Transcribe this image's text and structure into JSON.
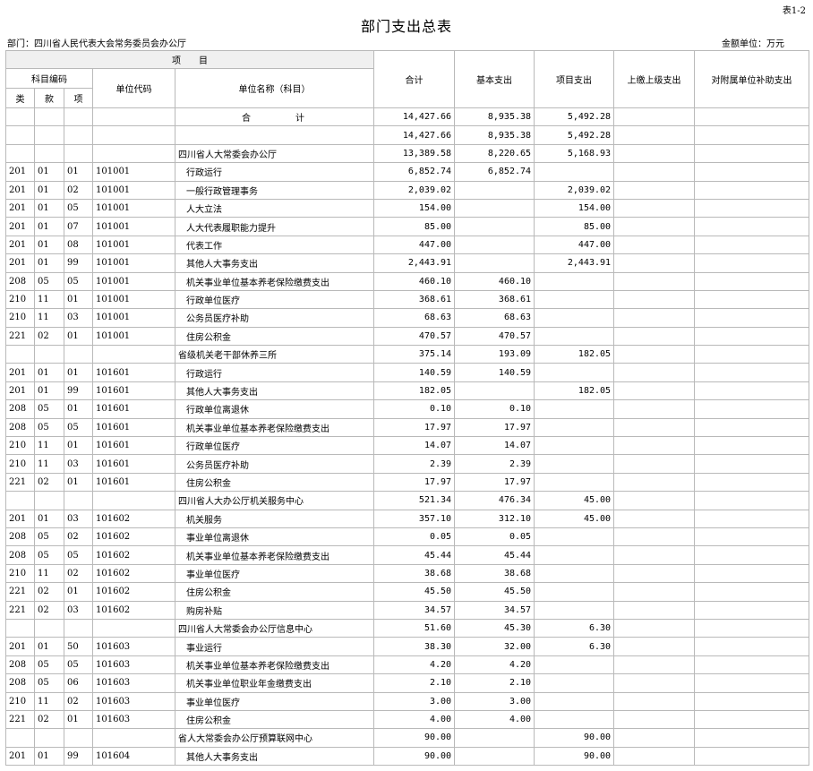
{
  "header": {
    "table_no": "表1-2",
    "title": "部门支出总表",
    "department": "部门：四川省人民代表大会常务委员会办公厅",
    "unit": "金额单位：万元"
  },
  "columns": {
    "project": "项　　目",
    "subject_code": "科目编码",
    "lei": "类",
    "kuan": "款",
    "xiang": "项",
    "unit_code": "单位代码",
    "unit_name": "单位名称（科目）",
    "total": "合计",
    "basic": "基本支出",
    "project_exp": "项目支出",
    "upper": "上缴上级支出",
    "subsidy": "对附属单位补助支出"
  },
  "rows": [
    {
      "lei": "",
      "kuan": "",
      "xiang": "",
      "code": "",
      "name": "合　计",
      "total": "14,427.66",
      "basic": "8,935.38",
      "project": "5,492.28",
      "kind": "total"
    },
    {
      "lei": "",
      "kuan": "",
      "xiang": "",
      "code": "",
      "name": "",
      "total": "14,427.66",
      "basic": "8,935.38",
      "project": "5,492.28",
      "kind": "unit"
    },
    {
      "lei": "",
      "kuan": "",
      "xiang": "",
      "code": "",
      "name": "四川省人大常委会办公厅",
      "total": "13,389.58",
      "basic": "8,220.65",
      "project": "5,168.93",
      "kind": "unit"
    },
    {
      "lei": "201",
      "kuan": "01",
      "xiang": "01",
      "code": "101001",
      "name": "行政运行",
      "total": "6,852.74",
      "basic": "6,852.74",
      "project": "",
      "kind": "item"
    },
    {
      "lei": "201",
      "kuan": "01",
      "xiang": "02",
      "code": "101001",
      "name": "一般行政管理事务",
      "total": "2,039.02",
      "basic": "",
      "project": "2,039.02",
      "kind": "item"
    },
    {
      "lei": "201",
      "kuan": "01",
      "xiang": "05",
      "code": "101001",
      "name": "人大立法",
      "total": "154.00",
      "basic": "",
      "project": "154.00",
      "kind": "item"
    },
    {
      "lei": "201",
      "kuan": "01",
      "xiang": "07",
      "code": "101001",
      "name": "人大代表履职能力提升",
      "total": "85.00",
      "basic": "",
      "project": "85.00",
      "kind": "item"
    },
    {
      "lei": "201",
      "kuan": "01",
      "xiang": "08",
      "code": "101001",
      "name": "代表工作",
      "total": "447.00",
      "basic": "",
      "project": "447.00",
      "kind": "item"
    },
    {
      "lei": "201",
      "kuan": "01",
      "xiang": "99",
      "code": "101001",
      "name": "其他人大事务支出",
      "total": "2,443.91",
      "basic": "",
      "project": "2,443.91",
      "kind": "item"
    },
    {
      "lei": "208",
      "kuan": "05",
      "xiang": "05",
      "code": "101001",
      "name": "机关事业单位基本养老保险缴费支出",
      "total": "460.10",
      "basic": "460.10",
      "project": "",
      "kind": "item"
    },
    {
      "lei": "210",
      "kuan": "11",
      "xiang": "01",
      "code": "101001",
      "name": "行政单位医疗",
      "total": "368.61",
      "basic": "368.61",
      "project": "",
      "kind": "item"
    },
    {
      "lei": "210",
      "kuan": "11",
      "xiang": "03",
      "code": "101001",
      "name": "公务员医疗补助",
      "total": "68.63",
      "basic": "68.63",
      "project": "",
      "kind": "item"
    },
    {
      "lei": "221",
      "kuan": "02",
      "xiang": "01",
      "code": "101001",
      "name": "住房公积金",
      "total": "470.57",
      "basic": "470.57",
      "project": "",
      "kind": "item"
    },
    {
      "lei": "",
      "kuan": "",
      "xiang": "",
      "code": "",
      "name": "省级机关老干部休养三所",
      "total": "375.14",
      "basic": "193.09",
      "project": "182.05",
      "kind": "unit"
    },
    {
      "lei": "201",
      "kuan": "01",
      "xiang": "01",
      "code": "101601",
      "name": "行政运行",
      "total": "140.59",
      "basic": "140.59",
      "project": "",
      "kind": "item"
    },
    {
      "lei": "201",
      "kuan": "01",
      "xiang": "99",
      "code": "101601",
      "name": "其他人大事务支出",
      "total": "182.05",
      "basic": "",
      "project": "182.05",
      "kind": "item"
    },
    {
      "lei": "208",
      "kuan": "05",
      "xiang": "01",
      "code": "101601",
      "name": "行政单位离退休",
      "total": "0.10",
      "basic": "0.10",
      "project": "",
      "kind": "item"
    },
    {
      "lei": "208",
      "kuan": "05",
      "xiang": "05",
      "code": "101601",
      "name": "机关事业单位基本养老保险缴费支出",
      "total": "17.97",
      "basic": "17.97",
      "project": "",
      "kind": "item"
    },
    {
      "lei": "210",
      "kuan": "11",
      "xiang": "01",
      "code": "101601",
      "name": "行政单位医疗",
      "total": "14.07",
      "basic": "14.07",
      "project": "",
      "kind": "item"
    },
    {
      "lei": "210",
      "kuan": "11",
      "xiang": "03",
      "code": "101601",
      "name": "公务员医疗补助",
      "total": "2.39",
      "basic": "2.39",
      "project": "",
      "kind": "item"
    },
    {
      "lei": "221",
      "kuan": "02",
      "xiang": "01",
      "code": "101601",
      "name": "住房公积金",
      "total": "17.97",
      "basic": "17.97",
      "project": "",
      "kind": "item"
    },
    {
      "lei": "",
      "kuan": "",
      "xiang": "",
      "code": "",
      "name": "四川省人大办公厅机关服务中心",
      "total": "521.34",
      "basic": "476.34",
      "project": "45.00",
      "kind": "unit"
    },
    {
      "lei": "201",
      "kuan": "01",
      "xiang": "03",
      "code": "101602",
      "name": "机关服务",
      "total": "357.10",
      "basic": "312.10",
      "project": "45.00",
      "kind": "item"
    },
    {
      "lei": "208",
      "kuan": "05",
      "xiang": "02",
      "code": "101602",
      "name": "事业单位离退休",
      "total": "0.05",
      "basic": "0.05",
      "project": "",
      "kind": "item"
    },
    {
      "lei": "208",
      "kuan": "05",
      "xiang": "05",
      "code": "101602",
      "name": "机关事业单位基本养老保险缴费支出",
      "total": "45.44",
      "basic": "45.44",
      "project": "",
      "kind": "item"
    },
    {
      "lei": "210",
      "kuan": "11",
      "xiang": "02",
      "code": "101602",
      "name": "事业单位医疗",
      "total": "38.68",
      "basic": "38.68",
      "project": "",
      "kind": "item"
    },
    {
      "lei": "221",
      "kuan": "02",
      "xiang": "01",
      "code": "101602",
      "name": "住房公积金",
      "total": "45.50",
      "basic": "45.50",
      "project": "",
      "kind": "item"
    },
    {
      "lei": "221",
      "kuan": "02",
      "xiang": "03",
      "code": "101602",
      "name": "购房补贴",
      "total": "34.57",
      "basic": "34.57",
      "project": "",
      "kind": "item"
    },
    {
      "lei": "",
      "kuan": "",
      "xiang": "",
      "code": "",
      "name": "四川省人大常委会办公厅信息中心",
      "total": "51.60",
      "basic": "45.30",
      "project": "6.30",
      "kind": "unit"
    },
    {
      "lei": "201",
      "kuan": "01",
      "xiang": "50",
      "code": "101603",
      "name": "事业运行",
      "total": "38.30",
      "basic": "32.00",
      "project": "6.30",
      "kind": "item"
    },
    {
      "lei": "208",
      "kuan": "05",
      "xiang": "05",
      "code": "101603",
      "name": "机关事业单位基本养老保险缴费支出",
      "total": "4.20",
      "basic": "4.20",
      "project": "",
      "kind": "item"
    },
    {
      "lei": "208",
      "kuan": "05",
      "xiang": "06",
      "code": "101603",
      "name": "机关事业单位职业年金缴费支出",
      "total": "2.10",
      "basic": "2.10",
      "project": "",
      "kind": "item"
    },
    {
      "lei": "210",
      "kuan": "11",
      "xiang": "02",
      "code": "101603",
      "name": "事业单位医疗",
      "total": "3.00",
      "basic": "3.00",
      "project": "",
      "kind": "item"
    },
    {
      "lei": "221",
      "kuan": "02",
      "xiang": "01",
      "code": "101603",
      "name": "住房公积金",
      "total": "4.00",
      "basic": "4.00",
      "project": "",
      "kind": "item"
    },
    {
      "lei": "",
      "kuan": "",
      "xiang": "",
      "code": "",
      "name": "省人大常委会办公厅预算联网中心",
      "total": "90.00",
      "basic": "",
      "project": "90.00",
      "kind": "unit"
    },
    {
      "lei": "201",
      "kuan": "01",
      "xiang": "99",
      "code": "101604",
      "name": "其他人大事务支出",
      "total": "90.00",
      "basic": "",
      "project": "90.00",
      "kind": "item"
    }
  ]
}
